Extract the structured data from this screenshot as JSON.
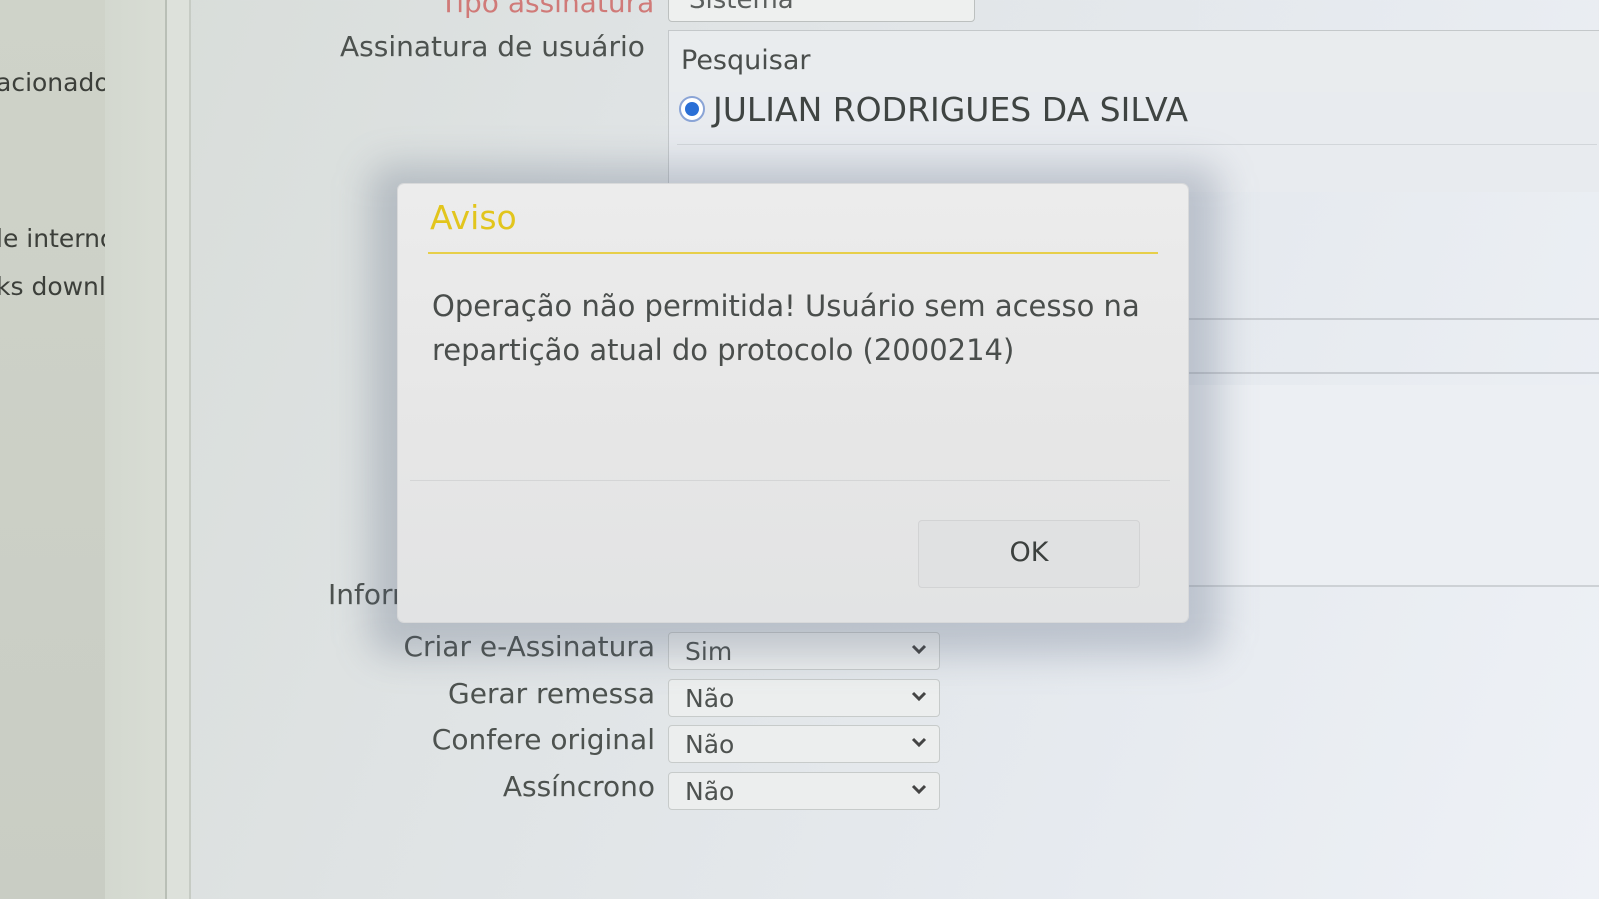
{
  "sidebar": {
    "items": [
      {
        "label": "acionado"
      },
      {
        "label": "le interno"
      },
      {
        "label": "ks downlo"
      }
    ]
  },
  "form": {
    "signature_type": {
      "label": "Tipo assinatura",
      "value": "Sistema"
    },
    "user_signature": {
      "label": "Assinatura de usuário",
      "search_placeholder": "Pesquisar",
      "selected_user": "JULIAN RODRIGUES DA SILVA"
    },
    "info_label": "Inform",
    "fields": [
      {
        "label": "Criar e-Assinatura",
        "value": "Sim"
      },
      {
        "label": "Gerar remessa",
        "value": "Não"
      },
      {
        "label": "Confere original",
        "value": "Não"
      },
      {
        "label": "Assíncrono",
        "value": "Não"
      }
    ]
  },
  "dialog": {
    "title": "Aviso",
    "message": "Operação não permitida! Usuário sem acesso na repartição atual do protocolo (2000214)",
    "ok_label": "OK"
  },
  "colors": {
    "dialog_title": "#e2c51c",
    "radio_selected": "#2a6fd6",
    "required_label": "#d07a78"
  }
}
